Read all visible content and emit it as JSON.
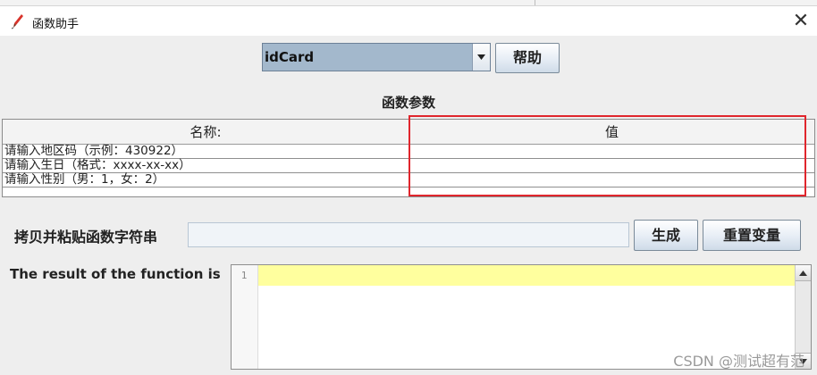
{
  "window": {
    "title": "函数助手",
    "icon": "feather-pen-icon",
    "close_icon": "close-icon"
  },
  "function_selector": {
    "selected": "idCard",
    "arrow_icon": "chevron-down-icon"
  },
  "help_button": "帮助",
  "params": {
    "title": "函数参数",
    "columns": [
      "名称:",
      "值"
    ],
    "rows": [
      {
        "name": "请输入地区码（示例：430922）",
        "value": ""
      },
      {
        "name": "请输入生日（格式：xxxx-xx-xx）",
        "value": ""
      },
      {
        "name": "请输入性别（男：1，女：2）",
        "value": ""
      }
    ]
  },
  "copy_section": {
    "label": "拷贝并粘贴函数字符串",
    "value": "",
    "generate_button": "生成",
    "reset_button": "重置变量"
  },
  "result": {
    "label": "The result of the function is",
    "line_number": "1",
    "text": ""
  },
  "watermark": "CSDN @测试超有范",
  "colors": {
    "combo_selected": "#a3b8cc",
    "highlight_box": "#e0262d",
    "current_line": "#ffff9e"
  }
}
